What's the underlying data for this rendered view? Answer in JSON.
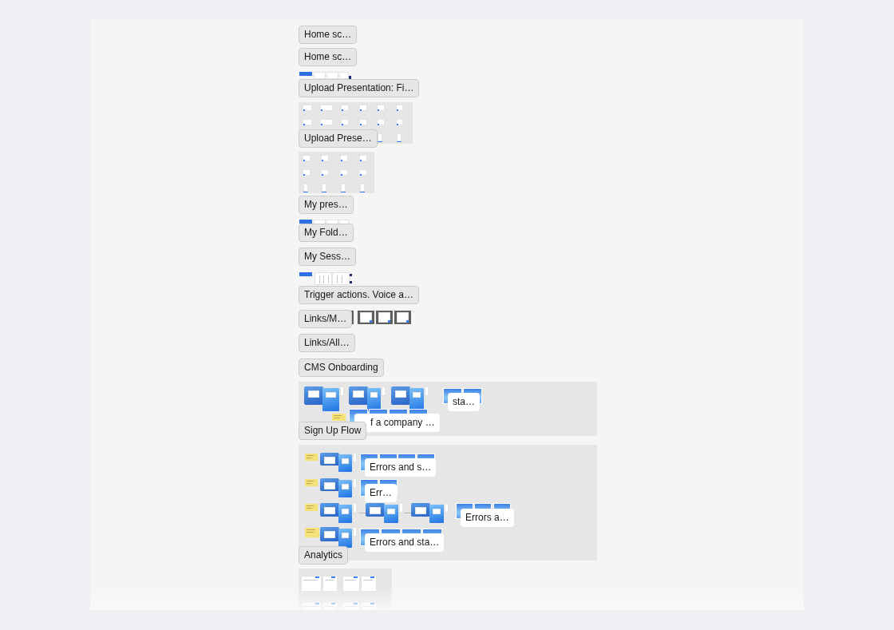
{
  "canvas": {
    "labels": [
      {
        "kind": "section",
        "text": "Home sc…"
      },
      {
        "kind": "section",
        "text": "Home sc…"
      },
      {
        "kind": "section",
        "text": "Upload Presentation: Fi…"
      },
      {
        "kind": "section",
        "text": "Upload Prese…"
      },
      {
        "kind": "section",
        "text": "My pres…"
      },
      {
        "kind": "section",
        "text": "My Fold…"
      },
      {
        "kind": "section",
        "text": "My Sess…"
      },
      {
        "kind": "section",
        "text": "Trigger actions. Voice a…"
      },
      {
        "kind": "section",
        "text": "Links/M…"
      },
      {
        "kind": "section",
        "text": "Links/All…"
      },
      {
        "kind": "section",
        "text": "CMS Onboarding"
      },
      {
        "kind": "frame",
        "text": "sta…"
      },
      {
        "kind": "frame",
        "text": "f a company …"
      },
      {
        "kind": "section",
        "text": "Sign Up Flow"
      },
      {
        "kind": "frame",
        "text": "Errors and s…"
      },
      {
        "kind": "frame",
        "text": "Err…"
      },
      {
        "kind": "frame",
        "text": "Errors a…"
      },
      {
        "kind": "frame",
        "text": "Errors and sta…"
      },
      {
        "kind": "section",
        "text": "Analytics"
      }
    ]
  }
}
